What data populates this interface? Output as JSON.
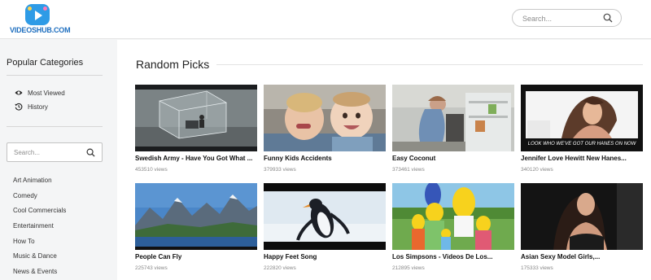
{
  "header": {
    "logo_text": "VIDEOSHUB.COM",
    "search_placeholder": "Search..."
  },
  "sidebar": {
    "heading": "Popular Categories",
    "links": [
      {
        "label": "Most Viewed",
        "icon": "eye-icon"
      },
      {
        "label": "History",
        "icon": "history-icon"
      }
    ],
    "search_placeholder": "Search...",
    "categories": [
      "Art Animation",
      "Comedy",
      "Cool Commercials",
      "Entertainment",
      "How To",
      "Music & Dance",
      "News & Events"
    ]
  },
  "main": {
    "section_title": "Random Picks",
    "videos": [
      {
        "title": "Swedish Army - Have You Got What ...",
        "views": "453510 views"
      },
      {
        "title": "Funny Kids Accidents",
        "views": "379933 views"
      },
      {
        "title": "Easy Coconut",
        "views": "373461 views"
      },
      {
        "title": "Jennifer Love Hewitt New Hanes...",
        "views": "340120 views",
        "caption": "LOOK WHO WE'VE GOT OUR HANES ON NOW"
      },
      {
        "title": "People Can Fly",
        "views": "225743 views"
      },
      {
        "title": "Happy Feet Song",
        "views": "222820 views"
      },
      {
        "title": "Los Simpsons - Videos De Los...",
        "views": "212895 views"
      },
      {
        "title": "Asian Sexy Model Girls,...",
        "views": "175333 views"
      }
    ]
  },
  "colors": {
    "brand_blue": "#2e9be6",
    "logo_text": "#1f6fbf",
    "caption_accent": "#e0105f"
  }
}
